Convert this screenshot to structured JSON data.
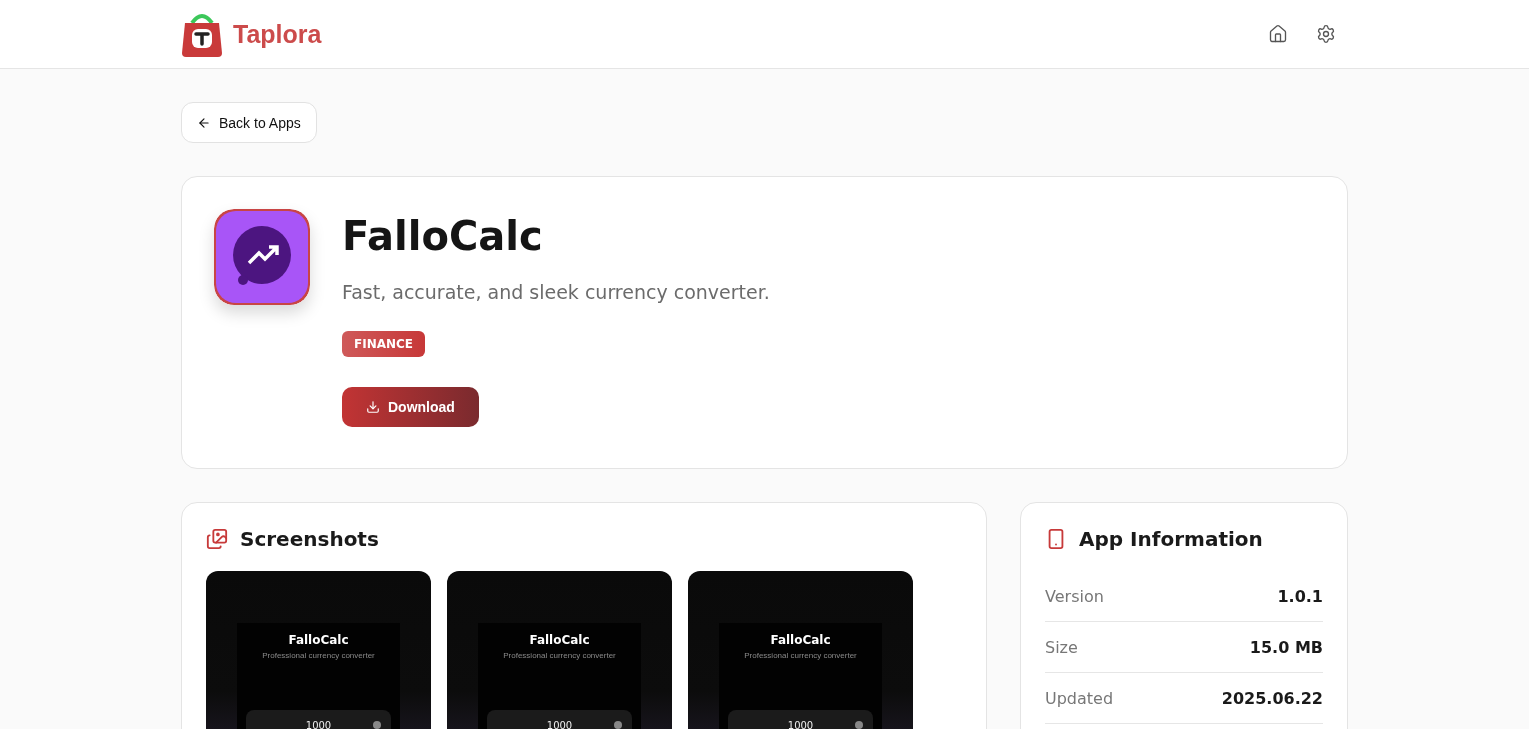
{
  "header": {
    "brand": "Taplora"
  },
  "back_button": {
    "label": "Back to Apps"
  },
  "app": {
    "name": "FalloCalc",
    "tagline": "Fast, accurate, and sleek currency converter.",
    "category": "FINANCE",
    "download": "Download"
  },
  "screenshots": {
    "title": "Screenshots",
    "items": [
      {
        "app_title": "FalloCalc",
        "subtitle": "Professional currency converter",
        "amount": "1000"
      },
      {
        "app_title": "FalloCalc",
        "subtitle": "Professional currency converter",
        "amount": "1000"
      },
      {
        "app_title": "FalloCalc",
        "subtitle": "Professional currency converter",
        "amount": "1000"
      }
    ]
  },
  "app_information": {
    "title": "App Information",
    "rows": [
      {
        "label": "Version",
        "value": "1.0.1"
      },
      {
        "label": "Size",
        "value": "15.0 MB"
      },
      {
        "label": "Updated",
        "value": "2025.06.22"
      }
    ]
  }
}
